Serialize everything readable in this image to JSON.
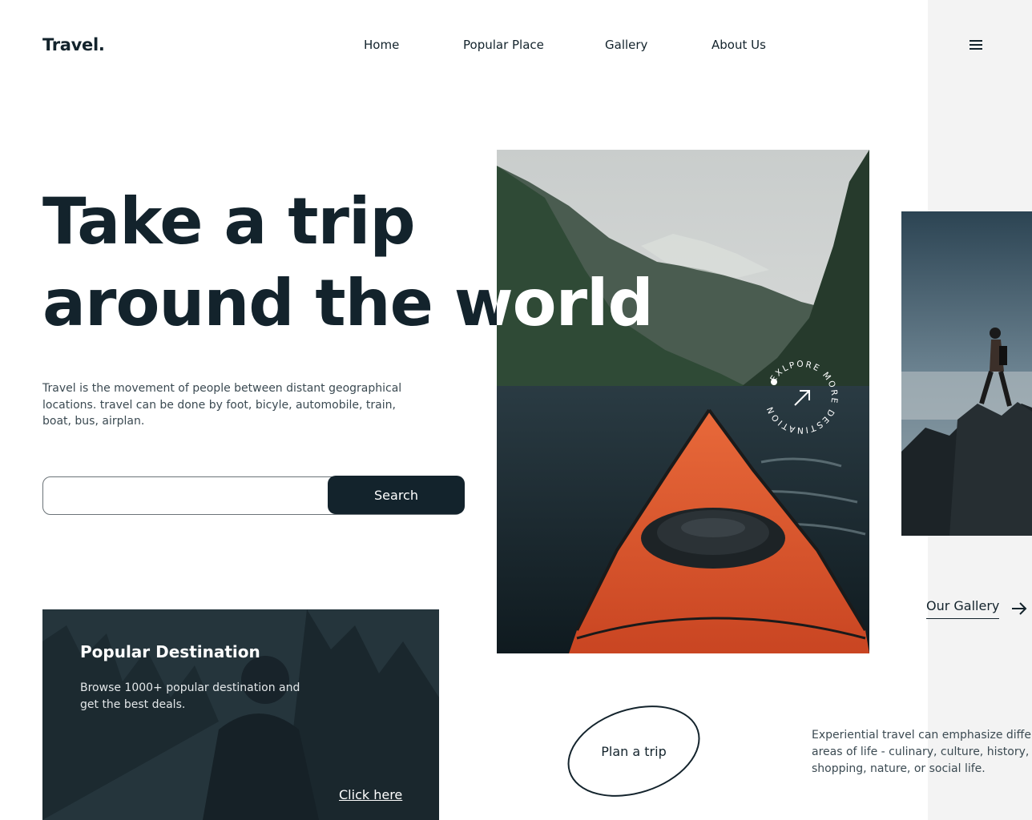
{
  "brand": {
    "logo": "Travel."
  },
  "nav": {
    "home": "Home",
    "popular": "Popular Place",
    "gallery": "Gallery",
    "about": "About Us",
    "menu_icon": "hamburger-menu-icon"
  },
  "hero": {
    "title_line1": "Take a trip",
    "title_line2": "around the world",
    "description": "Travel is the movement of people between distant geographical locations. travel can be done by foot, bicyle, automobile, train, boat, bus, airplan.",
    "search_placeholder": "",
    "search_button": "Search"
  },
  "badge": {
    "text": "EXLPORE MORE DESTINATION",
    "icon": "arrow-up-right-icon"
  },
  "gallery": {
    "link": "Our Gallery",
    "icon": "arrow-right-icon"
  },
  "promo": {
    "title": "Popular Destination",
    "description": "Browse 1000+ popular destination and get the best deals.",
    "link": "Click here"
  },
  "plan": {
    "label": "Plan a trip"
  },
  "experiential": {
    "line1": "Experiential travel can emphasize differe",
    "line2": "areas of life - culinary, culture, history,",
    "line3": "shopping, nature, or social life."
  },
  "colors": {
    "primary": "#13232c",
    "kayak": "#d9512c",
    "sidebar": "#f3f3f3"
  }
}
